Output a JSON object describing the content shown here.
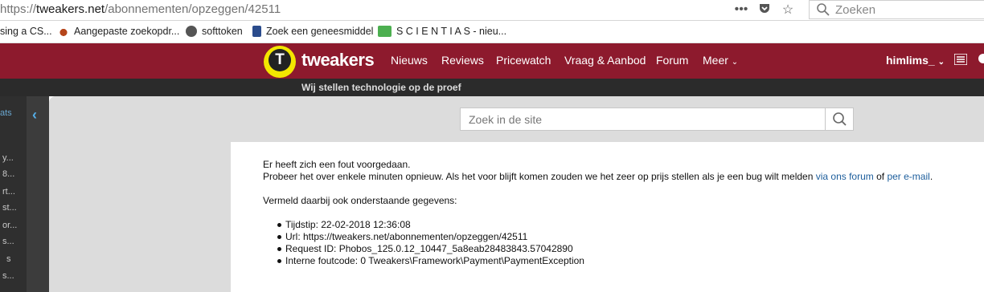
{
  "browser": {
    "url_prefix": "https://",
    "url_domain": "tweakers.net",
    "url_path": "/abonnementen/opzeggen/42511",
    "search_placeholder": "Zoeken",
    "bookmarks": [
      {
        "label": "sing a CS...",
        "icon": "none"
      },
      {
        "label": "Aangepaste zoekopdr...",
        "icon": "paw-icon"
      },
      {
        "label": "softtoken",
        "icon": "globe-icon"
      },
      {
        "label": "Zoek een geneesmiddel",
        "icon": "shield-icon"
      },
      {
        "label": "S C I E N T I A S - nieu...",
        "icon": "sci-icon"
      }
    ]
  },
  "header": {
    "brand": "tweakers",
    "logo_letter": "T",
    "nav": [
      "Nieuws",
      "Reviews",
      "Pricewatch",
      "Vraag & Aanbod",
      "Forum",
      "Meer"
    ],
    "username": "himlims_",
    "tagline": "Wij stellen technologie op de proef"
  },
  "sidebar": {
    "items": [
      "ats",
      "y...",
      "8...",
      "rt...",
      "st...",
      "or...",
      "s...",
      "s",
      "s..."
    ]
  },
  "site_search": {
    "placeholder": "Zoek in de site"
  },
  "error": {
    "line1": "Er heeft zich een fout voorgedaan.",
    "line2_text": "Probeer het over enkele minuten opnieuw. Als het voor blijft komen zouden we het zeer op prijs stellen als je een bug wilt melden ",
    "link_forum": "via ons forum",
    "line2_mid": " of ",
    "link_email": "per e-mail",
    "line2_end": ".",
    "details_intro": "Vermeld daarbij ook onderstaande gegevens:",
    "details": [
      "Tijdstip: 22-02-2018 12:36:08",
      "Url: https://tweakers.net/abonnementen/opzeggen/42511",
      "Request ID: Phobos_125.0.12_10447_5a8eab28483843.57042890",
      "Interne foutcode: 0 Tweakers\\Framework\\Payment\\PaymentException"
    ]
  },
  "colors": {
    "header": "#8d1a2d",
    "logo_yellow": "#f3e600",
    "link": "#1d5e9c"
  }
}
